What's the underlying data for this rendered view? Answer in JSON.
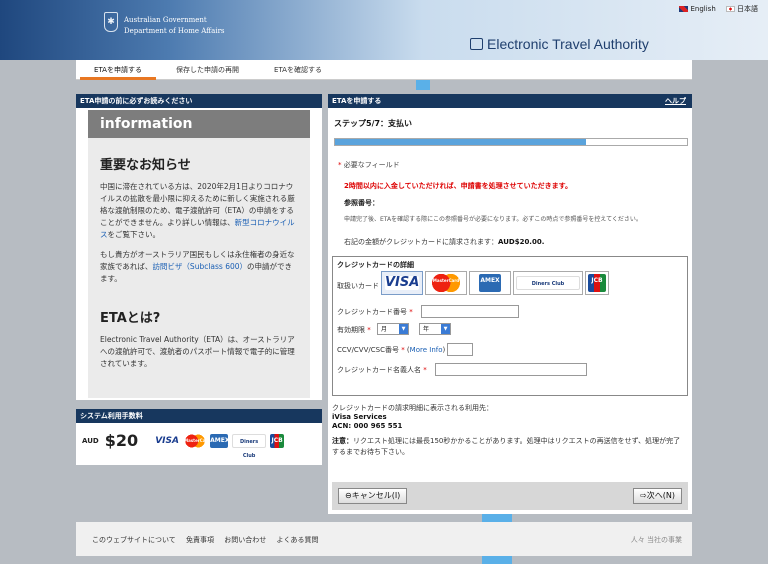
{
  "header": {
    "gov_line1": "Australian Government",
    "gov_line2": "Department of Home Affairs",
    "crest_glyph": "✱",
    "title": "Electronic Travel Authority",
    "lang": {
      "en": "English",
      "ja": "日本語"
    }
  },
  "nav": {
    "tabs": [
      {
        "label": "ETAを申請する"
      },
      {
        "label": "保存した申請の再開"
      },
      {
        "label": "ETAを確認する"
      }
    ]
  },
  "info_panel": {
    "header": "ETA申請の前に必ずお読みください",
    "title": "information",
    "notice_heading": "重要なお知らせ",
    "notice_text": "中国に滞在されている方は、2020年2月1日よりコロナウイルスの拡散を最小限に抑えるために新しく実施される厳格な渡航制限のため、電子渡航許可（ETA）の申請をすることができません。より詳しい情報は、",
    "notice_link": "新型コロナウイルス",
    "notice_tail": "をご覧下さい。",
    "pr_text": "もし貴方がオーストラリア国民もしくは永住権者の身近な家族であれば、",
    "pr_link": "訪問ビザ（Subclass 600）",
    "pr_tail": "の申請ができます。",
    "eta_heading": "ETAとは?",
    "eta_text": "Electronic Travel Authority（ETA）は、オーストラリアへの渡航許可で、渡航者のパスポート情報で電子的に管理されています。"
  },
  "fee_panel": {
    "header": "システム利用手数料",
    "currency": "AUD",
    "amount": "$20",
    "cards": {
      "visa": "VISA",
      "mc": "MasterCard",
      "amex": "AMEX",
      "diners": "Diners Club",
      "jcb": "JCB"
    }
  },
  "main_panel": {
    "header": "ETAを申請する",
    "help": "ヘルプ",
    "step": "ステップ5/7：支払い",
    "progress_fraction": 0.714,
    "required_note": "必要なフィールド",
    "warning": "2時間以内に入金していただければ、申請書を処理させていただきます。",
    "ref_label": "参照番号：",
    "ref_note": "申請完了後、ETAを確認する際にこの参照番号が必要になります。必ずこの時点で参照番号を控えてください。",
    "charge_text": "右記の金額がクレジットカードに請求されます：",
    "charge_amount": "AUD$20.00.",
    "cc": {
      "header": "クレジットカードの詳細",
      "card_type_label": "取扱いカード",
      "card_number_label": "クレジットカード番号",
      "expiry_label": "有効期限",
      "month_placeholder": "月",
      "year_placeholder": "年",
      "cvv_label": "CCV/CVV/CSC番号",
      "more_info": "More Info",
      "name_label": "クレジットカード名義人名"
    },
    "issuer_label": "クレジットカードの請求明細に表示される利用先：",
    "issuer_name": "iVisa Services",
    "issuer_acn": "ACN: 000 965 551",
    "caution_bold": "注意：",
    "caution_text": "リクエスト処理には最長150秒かかることがあります。処理中はリクエストの再送信をせず、処理が完了するまでお待ち下さい。",
    "cancel_btn": "⊖キャンセル(I)",
    "next_btn": "⇨次へ(N)"
  },
  "footer": {
    "links": [
      "このウェブサイトについて",
      "免責事項",
      "お問い合わせ",
      "よくある質問"
    ],
    "right": "人々 当社の事業"
  },
  "colors": {
    "panel_header": "#17375e",
    "accent": "#e87722",
    "warning": "#dd0000",
    "link": "#1a5fb4"
  }
}
